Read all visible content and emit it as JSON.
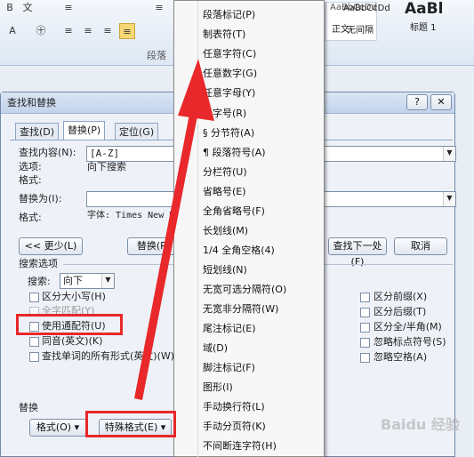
{
  "ribbon": {
    "row1": [
      "B",
      "文",
      "≡",
      "≡",
      "AaBbCcDd",
      "AaBbCcDd",
      "AaBl"
    ],
    "row2": [
      "A",
      "㊉",
      "≡",
      "≡",
      "≡",
      "≡"
    ],
    "styles": [
      "正文",
      "无间隔",
      "标题 1"
    ],
    "group_paragraph": "段落"
  },
  "dialog": {
    "title": "查找和替换",
    "help": "?",
    "close": "✕",
    "tabs": [
      "查找(D)",
      "替换(P)",
      "定位(G)"
    ],
    "find_label": "查找内容(N):",
    "find_value": "[A-Z]",
    "options_label": "选项:",
    "options_value": "向下搜索",
    "format_label": "格式:",
    "replace_label": "替换为(I):",
    "replace_value": "",
    "format2_label": "格式:",
    "format2_value": "字体: Times New Ro",
    "less_btn": "<< 更少(L)",
    "replace_btn": "替换(R)",
    "find_next_btn": "查找下一处(F)",
    "cancel_btn": "取消",
    "search_options": "搜索选项",
    "search_label": "搜索:",
    "search_value": "向下",
    "checks_left": [
      "区分大小写(H)",
      "全字匹配(Y)",
      "使用通配符(U)",
      "同音(英文)(K)",
      "查找单词的所有形式(英文)(W)"
    ],
    "checks_right": [
      "区分前缀(X)",
      "区分后缀(T)",
      "区分全/半角(M)",
      "忽略标点符号(S)",
      "忽略空格(A)"
    ],
    "replace_section": "替换",
    "format_btn": "格式(O) ▾",
    "special_btn": "特殊格式(E) ▾"
  },
  "menu": {
    "items": [
      "段落标记(P)",
      "制表符(T)",
      "任意字符(C)",
      "任意数字(G)",
      "任意字母(Y)",
      "脱字号(R)",
      "§ 分节符(A)",
      "¶ 段落符号(A)",
      "分栏符(U)",
      "省略号(E)",
      "全角省略号(F)",
      "长划线(M)",
      "1/4 全角空格(4)",
      "短划线(N)",
      "无宽可选分隔符(O)",
      "无宽非分隔符(W)",
      "尾注标记(E)",
      "域(D)",
      "脚注标记(F)",
      "图形(I)",
      "手动换行符(L)",
      "手动分页符(K)",
      "不间断连字符(H)"
    ]
  },
  "watermark": "Baidu 经验",
  "colors": {
    "highlight": "#e8282a",
    "arrow": "#e8282a"
  }
}
